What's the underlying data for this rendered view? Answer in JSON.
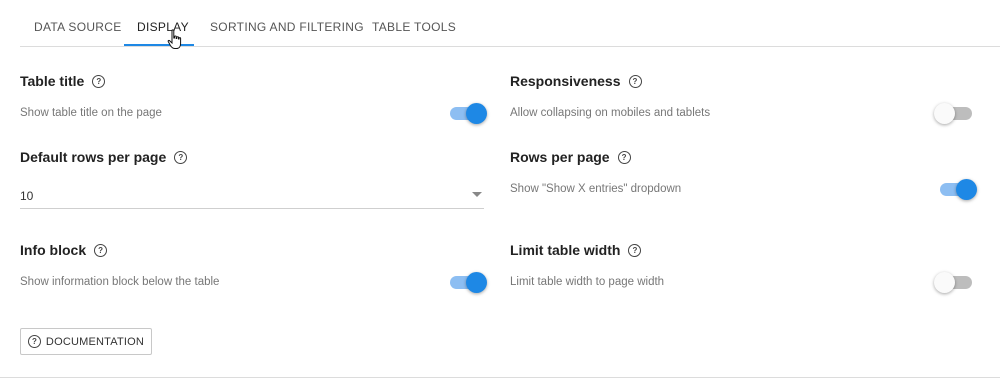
{
  "tabs": [
    {
      "label": "DATA SOURCE"
    },
    {
      "label": "DISPLAY",
      "active": true
    },
    {
      "label": "SORTING AND FILTERING"
    },
    {
      "label": "TABLE TOOLS"
    }
  ],
  "settings": {
    "table_title": {
      "title": "Table title",
      "description": "Show table title on the page",
      "enabled": true
    },
    "responsiveness": {
      "title": "Responsiveness",
      "description": "Allow collapsing on mobiles and tablets",
      "enabled": false
    },
    "default_rows": {
      "title": "Default rows per page",
      "value": "10"
    },
    "rows_per_page": {
      "title": "Rows per page",
      "description": "Show \"Show X entries\" dropdown",
      "enabled": true
    },
    "info_block": {
      "title": "Info block",
      "description": "Show information block below the table",
      "enabled": true
    },
    "limit_width": {
      "title": "Limit table width",
      "description": "Limit table width to page width",
      "enabled": false
    }
  },
  "documentation_button": {
    "label": "DOCUMENTATION"
  },
  "icons": {
    "help": "help-circle-icon",
    "dropdown": "caret-down-icon",
    "cursor": "hand-pointer-icon"
  },
  "colors": {
    "accent": "#1e88e5",
    "accent_light": "#8dbef2",
    "toggle_off": "#bdbdbd"
  }
}
